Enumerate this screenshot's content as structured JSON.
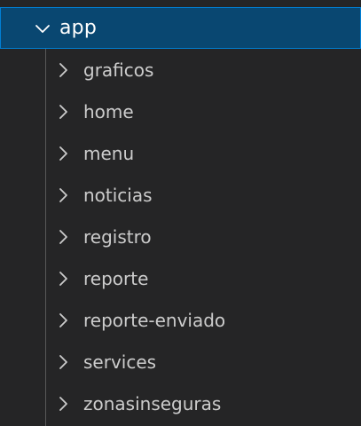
{
  "explorer": {
    "root": {
      "label": "app",
      "icon": "chevron-down-icon",
      "expanded": true
    },
    "children": [
      {
        "label": "graficos",
        "icon": "chevron-right-icon"
      },
      {
        "label": "home",
        "icon": "chevron-right-icon"
      },
      {
        "label": "menu",
        "icon": "chevron-right-icon"
      },
      {
        "label": "noticias",
        "icon": "chevron-right-icon"
      },
      {
        "label": "registro",
        "icon": "chevron-right-icon"
      },
      {
        "label": "reporte",
        "icon": "chevron-right-icon"
      },
      {
        "label": "reporte-enviado",
        "icon": "chevron-right-icon"
      },
      {
        "label": "services",
        "icon": "chevron-right-icon"
      },
      {
        "label": "zonasinseguras",
        "icon": "chevron-right-icon"
      }
    ]
  },
  "colors": {
    "background": "#252526",
    "selection": "#094771",
    "selection_border": "#007fd4",
    "text": "#cccccc",
    "indent_guide": "#585858"
  }
}
